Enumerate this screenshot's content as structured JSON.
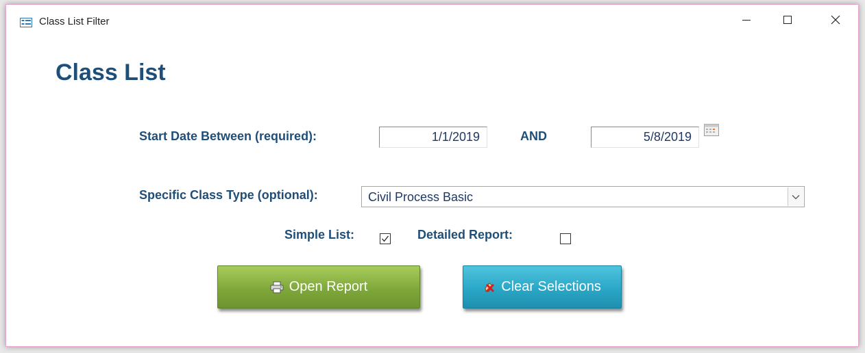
{
  "window": {
    "title": "Class List Filter",
    "icon": "form-icon",
    "controls": [
      "minimize-icon",
      "maximize-icon",
      "close-icon"
    ]
  },
  "form": {
    "heading": "Class List",
    "start_date_label": "Start Date Between (required):",
    "start_date_value": "1/1/2019",
    "and_label": "AND",
    "end_date_value": "5/8/2019",
    "class_type_label": "Specific Class Type (optional):",
    "class_type_value": "Civil Process Basic",
    "simple_list_label": "Simple List:",
    "simple_list_checked": true,
    "detailed_report_label": "Detailed Report:",
    "detailed_report_checked": false
  },
  "buttons": {
    "open_report_label": "Open Report",
    "open_report_icon": "printer-icon",
    "clear_selections_label": "Clear Selections",
    "clear_selections_icon": "eraser-x-icon"
  },
  "colors": {
    "label_text": "#1f4e79",
    "open_button": "#8cb548",
    "clear_button": "#31aacb",
    "window_border": "#e6a7d3"
  }
}
